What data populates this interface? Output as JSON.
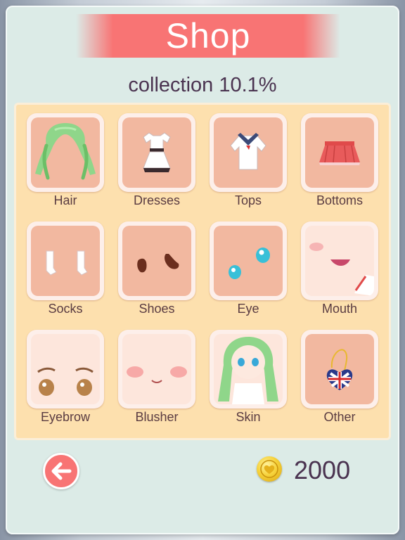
{
  "shop": {
    "title": "Shop",
    "collection_text": "collection 10.1%",
    "coins": "2000"
  },
  "categories": [
    {
      "label": "Hair",
      "icon": "hair-icon"
    },
    {
      "label": "Dresses",
      "icon": "dress-icon"
    },
    {
      "label": "Tops",
      "icon": "top-icon"
    },
    {
      "label": "Bottoms",
      "icon": "skirt-icon"
    },
    {
      "label": "Socks",
      "icon": "socks-icon"
    },
    {
      "label": "Shoes",
      "icon": "shoes-icon"
    },
    {
      "label": "Eye",
      "icon": "eye-icon"
    },
    {
      "label": "Mouth",
      "icon": "mouth-icon"
    },
    {
      "label": "Eyebrow",
      "icon": "eyebrow-icon"
    },
    {
      "label": "Blusher",
      "icon": "blusher-icon"
    },
    {
      "label": "Skin",
      "icon": "skin-icon"
    },
    {
      "label": "Other",
      "icon": "heart-pendant-icon"
    }
  ],
  "colors": {
    "banner": "#f87474",
    "panel": "#dcebe7",
    "grid_background": "#fde0ae",
    "tile": "#f2b8a0",
    "text": "#4a3350"
  }
}
